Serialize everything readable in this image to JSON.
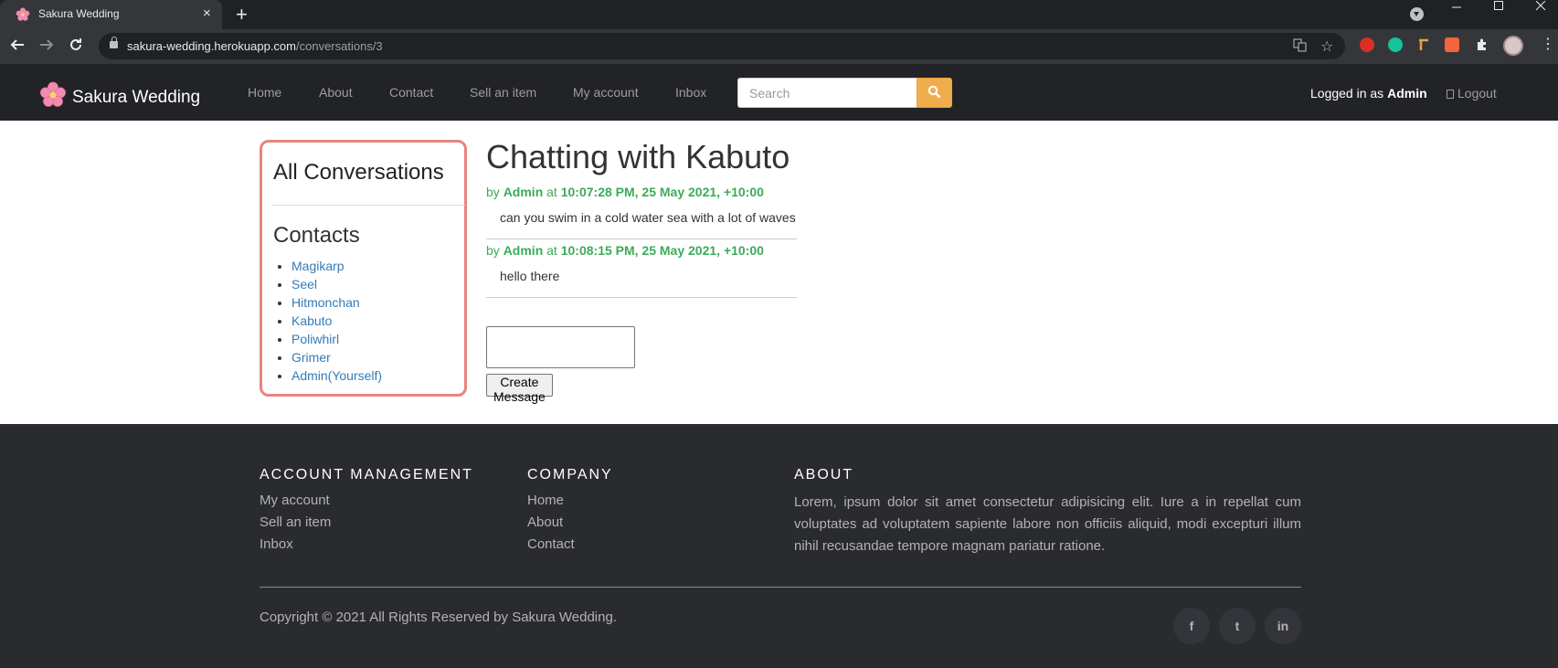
{
  "browser": {
    "tab_title": "Sakura Wedding",
    "tab_close": "×",
    "new_tab": "+",
    "url_host": "sakura-wedding.herokuapp.com",
    "url_path": "/conversations/3"
  },
  "navbar": {
    "brand": "Sakura Wedding",
    "links": [
      "Home",
      "About",
      "Contact",
      "Sell an item",
      "My account",
      "Inbox"
    ],
    "search_placeholder": "Search",
    "logged_in_prefix": "Logged in as",
    "logged_in_user": "Admin",
    "logout_label": "Logout"
  },
  "sidebar": {
    "heading": "All Conversations",
    "contacts_heading": "Contacts",
    "contacts": [
      "Magikarp",
      "Seel",
      "Hitmonchan",
      "Kabuto",
      "Poliwhirl",
      "Grimer",
      "Admin(Yourself)"
    ]
  },
  "chat": {
    "title": "Chatting with Kabuto",
    "by": "by",
    "at": "at",
    "messages": [
      {
        "author": "Admin",
        "time": "10:07:28 PM, 25 May 2021, +10:00",
        "text": "can you swim in a cold water sea with a lot of waves"
      },
      {
        "author": "Admin",
        "time": "10:08:15 PM, 25 May 2021, +10:00",
        "text": "hello there"
      }
    ],
    "message_value": "",
    "create_button": "Create Message"
  },
  "footer": {
    "account_heading": "ACCOUNT MANAGEMENT",
    "account_links": [
      "My account",
      "Sell an item",
      "Inbox"
    ],
    "company_heading": "COMPANY",
    "company_links": [
      "Home",
      "About",
      "Contact"
    ],
    "about_heading": "ABOUT",
    "about_text": "Lorem, ipsum dolor sit amet consectetur adipisicing elit. Iure a in repellat cum voluptates ad voluptatem sapiente labore non officiis aliquid, modi excepturi illum nihil recusandae tempore magnam pariatur ratione.",
    "copyright": "Copyright © 2021 All Rights Reserved by Sakura Wedding.",
    "social": [
      "f",
      "t",
      "in"
    ]
  },
  "colors": {
    "accent_search": "#f0ad4e",
    "sidebar_border": "#e8847e",
    "meta_green": "#3cab59",
    "link_blue": "#337ab7"
  },
  "icons": {
    "tab_favicon": "sakura-flower-icon",
    "brand_logo": "sakura-flower-icon",
    "search": "search-icon",
    "logout": "logout-icon",
    "facebook": "facebook-icon",
    "twitter": "twitter-icon",
    "linkedin": "linkedin-icon"
  }
}
